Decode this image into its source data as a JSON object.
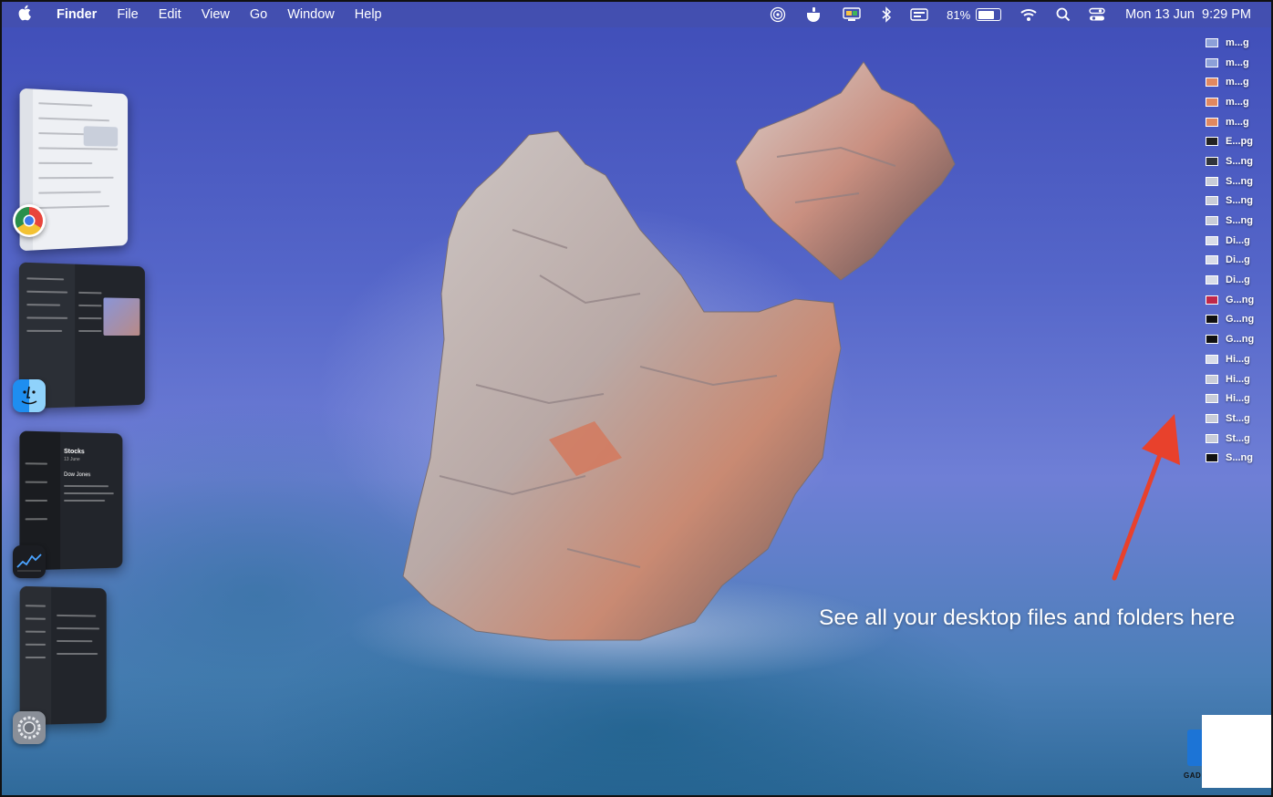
{
  "menubar": {
    "apple_icon": "apple-logo-icon",
    "items": [
      "Finder",
      "File",
      "Edit",
      "View",
      "Go",
      "Window",
      "Help"
    ],
    "status_icons": [
      "airdrop-icon",
      "coffee-cup-icon",
      "display-icon",
      "bluetooth-icon",
      "keyboard-icon"
    ],
    "battery_percent": "81%",
    "wifi_icon": "wifi-icon",
    "search_icon": "search-icon",
    "control_center_icon": "control-center-icon",
    "datetime": "Mon 13 Jun  9:29 PM"
  },
  "stage_manager": {
    "groups": [
      {
        "app_icon": "chrome-icon",
        "window": "light"
      },
      {
        "app_icon": "finder-icon",
        "window": "dark"
      },
      {
        "app_icon": "stocks-icon",
        "window": "dark",
        "title": "Stocks",
        "subtitle": "13 June",
        "headline": "Dow Jones"
      },
      {
        "app_icon": "system-preferences-icon",
        "window": "dark"
      }
    ]
  },
  "desktop_files": [
    {
      "name": "m...g",
      "thumb_color": "#8ca0d8"
    },
    {
      "name": "m...g",
      "thumb_color": "#8ca0d8"
    },
    {
      "name": "m...g",
      "thumb_color": "#e08860"
    },
    {
      "name": "m...g",
      "thumb_color": "#e08860"
    },
    {
      "name": "m...g",
      "thumb_color": "#e08860"
    },
    {
      "name": "E...pg",
      "thumb_color": "#222222"
    },
    {
      "name": "S...ng",
      "thumb_color": "#30343c"
    },
    {
      "name": "S...ng",
      "thumb_color": "#c8ccd8"
    },
    {
      "name": "S...ng",
      "thumb_color": "#c8ccd8"
    },
    {
      "name": "S...ng",
      "thumb_color": "#c8ccd8"
    },
    {
      "name": "Di...g",
      "thumb_color": "#d8dce8"
    },
    {
      "name": "Di...g",
      "thumb_color": "#d8dce8"
    },
    {
      "name": "Di...g",
      "thumb_color": "#d8dce8"
    },
    {
      "name": "G...ng",
      "thumb_color": "#c0284a"
    },
    {
      "name": "G...ng",
      "thumb_color": "#111111"
    },
    {
      "name": "G...ng",
      "thumb_color": "#111111"
    },
    {
      "name": "Hi...g",
      "thumb_color": "#d8dce8"
    },
    {
      "name": "Hi...g",
      "thumb_color": "#c8ccd8"
    },
    {
      "name": "Hi...g",
      "thumb_color": "#c8ccd8"
    },
    {
      "name": "St...g",
      "thumb_color": "#c8ccd8"
    },
    {
      "name": "St...g",
      "thumb_color": "#c8ccd8"
    },
    {
      "name": "S...ng",
      "thumb_color": "#111111"
    }
  ],
  "annotation": {
    "caption": "See all your desktop files and folders here",
    "arrow_color": "#e8412c"
  },
  "watermark": {
    "text": "GAD"
  }
}
